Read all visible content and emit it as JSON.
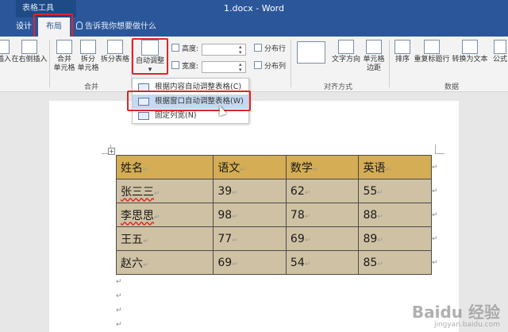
{
  "window": {
    "context_tab_group": "表格工具",
    "title": "1.docx - Word"
  },
  "tabs": {
    "design": "设计",
    "layout": "布局",
    "tell_me": "告诉我你想要做什么"
  },
  "ribbon": {
    "insert_left": "插入",
    "insert_right": "在右侧插入",
    "merge_cells": [
      "合并",
      "单元格"
    ],
    "split_cells": [
      "拆分",
      "单元格"
    ],
    "split_table": "拆分表格",
    "merge_group": "合并",
    "autofit": "自动调整",
    "height_label": "高度:",
    "width_label": "宽度:",
    "distribute_rows": "分布行",
    "distribute_cols": "分布列",
    "text_direction": "文字方向",
    "cell_margins": [
      "单元格",
      "边距"
    ],
    "alignment_group": "对齐方式",
    "sort": "排序",
    "repeat_header": "重复标题行",
    "convert_to_text": "转换为文本",
    "formula": "公式",
    "data_group": "数据"
  },
  "autofit_menu": {
    "items": [
      {
        "label": "根据内容自动调整表格(C)",
        "highlighted": false
      },
      {
        "label": "根据窗口自动调整表格(W)",
        "highlighted": true
      },
      {
        "label": "固定列宽(N)",
        "highlighted": false
      }
    ]
  },
  "table": {
    "header": [
      "姓名",
      "语文",
      "数学",
      "英语"
    ],
    "rows": [
      [
        "张三三",
        "39",
        "62",
        "55"
      ],
      [
        "李思思",
        "98",
        "78",
        "88"
      ],
      [
        "王五",
        "77",
        "69",
        "89"
      ],
      [
        "赵六",
        "69",
        "54",
        "85"
      ]
    ],
    "cell_mark": "↵",
    "header_color": "#d4ad54",
    "body_color": "#cfc2a4"
  },
  "watermark": {
    "logo": "Baidu 经验",
    "url": "jingyan.baidu.com"
  },
  "colors": {
    "ribbon_blue": "#2b579a",
    "highlight_red": "#e0242a",
    "menu_highlight": "#c5d9f1"
  }
}
